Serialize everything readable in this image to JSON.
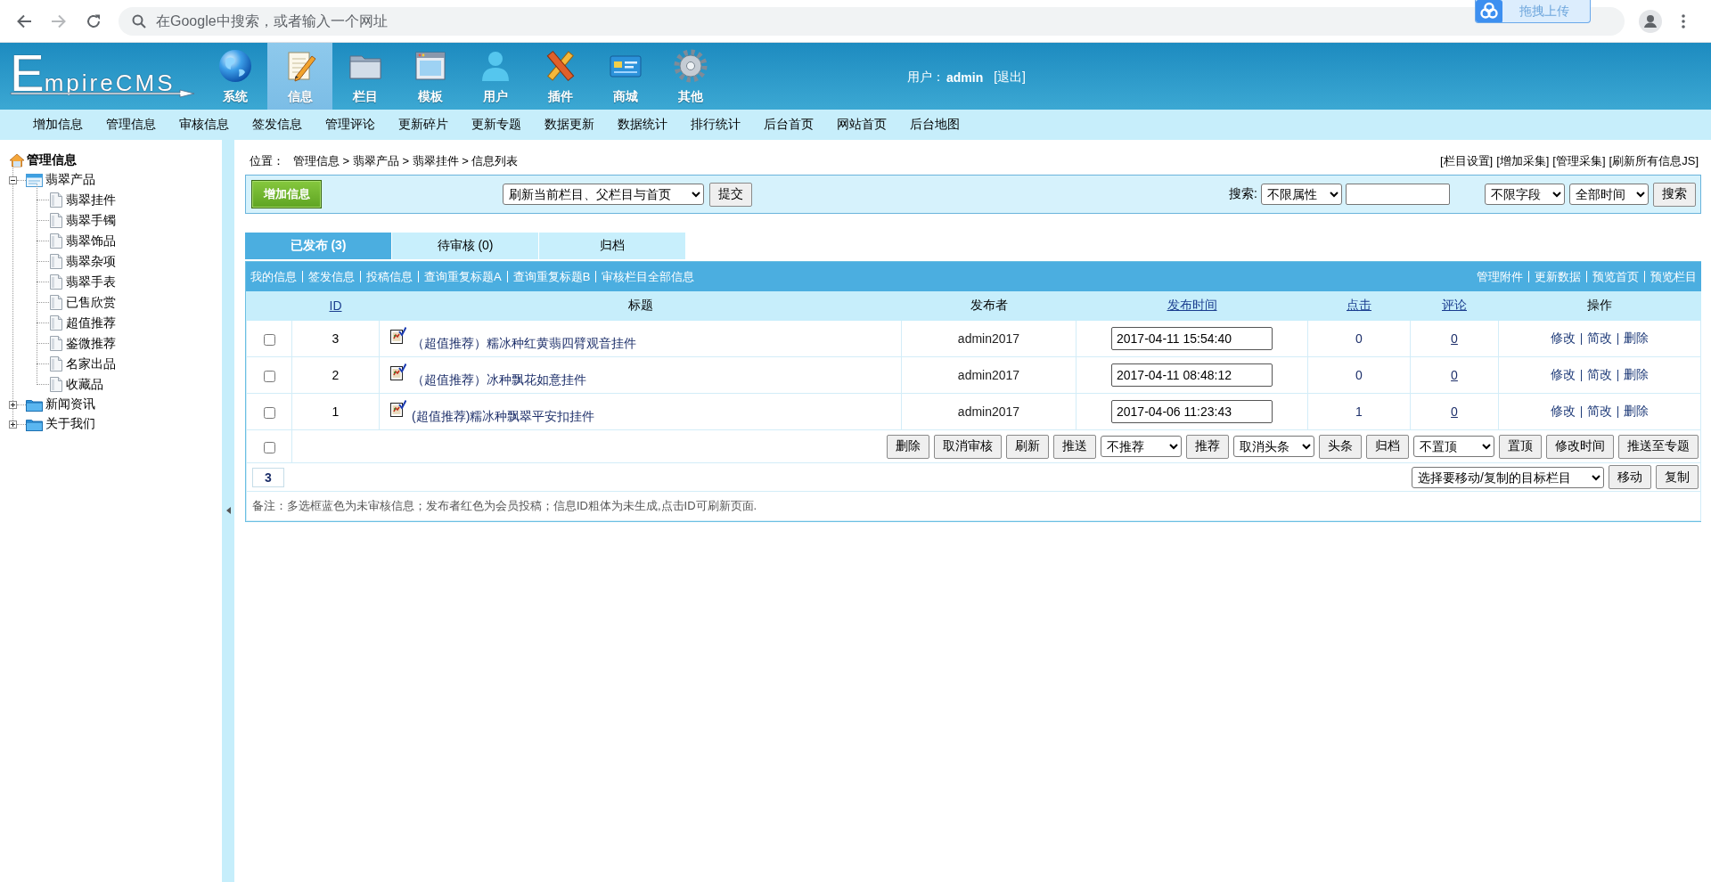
{
  "browser": {
    "address_placeholder": "在Google中搜索，或者输入一个网址",
    "extension_label": "拖拽上传"
  },
  "header": {
    "logo": "EmpireCMS",
    "nav": [
      {
        "label": "系统",
        "selected": false
      },
      {
        "label": "信息",
        "selected": true
      },
      {
        "label": "栏目",
        "selected": false
      },
      {
        "label": "模板",
        "selected": false
      },
      {
        "label": "用户",
        "selected": false
      },
      {
        "label": "插件",
        "selected": false
      },
      {
        "label": "商城",
        "selected": false
      },
      {
        "label": "其他",
        "selected": false
      }
    ],
    "user_label": "用户：",
    "user_name": "admin",
    "logout": "[退出]"
  },
  "submenu": [
    "增加信息",
    "管理信息",
    "审核信息",
    "签发信息",
    "管理评论",
    "更新碎片",
    "更新专题",
    "数据更新",
    "数据统计",
    "排行统计",
    "后台首页",
    "网站首页",
    "后台地图"
  ],
  "sidebar": {
    "title": "管理信息",
    "tree": [
      {
        "label": "翡翠产品",
        "expanded": true,
        "children": [
          {
            "label": "翡翠挂件"
          },
          {
            "label": "翡翠手镯"
          },
          {
            "label": "翡翠饰品"
          },
          {
            "label": "翡翠杂项"
          },
          {
            "label": "翡翠手表"
          },
          {
            "label": "已售欣赏"
          },
          {
            "label": "超值推荐"
          },
          {
            "label": "鉴微推荐"
          },
          {
            "label": "名家出品"
          },
          {
            "label": "收藏品"
          }
        ]
      },
      {
        "label": "新闻资讯",
        "expanded": false
      },
      {
        "label": "关于我们",
        "expanded": false
      }
    ]
  },
  "breadcrumb": {
    "label": "位置：",
    "path": "管理信息 > 翡翠产品 > 翡翠挂件 > 信息列表"
  },
  "top_links": [
    "[栏目设置]",
    "[增加采集]",
    "[管理采集]",
    "[刷新所有信息JS]"
  ],
  "toolbar": {
    "add_button": "增加信息",
    "refresh_select": "刷新当前栏目、父栏目与首页",
    "submit": "提交",
    "search_label": "搜索:",
    "attribute_select": "不限属性",
    "field_select": "不限字段",
    "time_select": "全部时间",
    "search_button": "搜索"
  },
  "tabs": [
    {
      "label": "已发布 (3)",
      "selected": true
    },
    {
      "label": "待审核 (0)",
      "selected": false
    },
    {
      "label": "归档",
      "selected": false
    }
  ],
  "table": {
    "links_left": [
      "我的信息",
      "签发信息",
      "投稿信息",
      "查询重复标题A",
      "查询重复标题B",
      "审核栏目全部信息"
    ],
    "links_right": [
      "管理附件",
      "更新数据",
      "预览首页",
      "预览栏目"
    ],
    "columns": [
      {
        "label": "ID",
        "link": true
      },
      {
        "label": "标题",
        "link": false
      },
      {
        "label": "发布者",
        "link": false
      },
      {
        "label": "发布时间",
        "link": true
      },
      {
        "label": "点击",
        "link": true
      },
      {
        "label": "评论",
        "link": true
      },
      {
        "label": "操作",
        "link": false
      }
    ],
    "rows": [
      {
        "checked": false,
        "id": "3",
        "title": "（超值推荐）糯冰种红黄翡四臂观音挂件",
        "author": "admin2017",
        "time": "2017-04-11 15:54:40",
        "clicks": "0",
        "comments": "0",
        "actions": [
          "修改",
          "简改",
          "删除"
        ]
      },
      {
        "checked": false,
        "id": "2",
        "title": "（超值推荐）冰种飘花如意挂件",
        "author": "admin2017",
        "time": "2017-04-11 08:48:12",
        "clicks": "0",
        "comments": "0",
        "actions": [
          "修改",
          "简改",
          "删除"
        ]
      },
      {
        "checked": false,
        "id": "1",
        "title": "(超值推荐)糯冰种飘翠平安扣挂件",
        "author": "admin2017",
        "time": "2017-04-06 11:23:43",
        "clicks": "1",
        "comments": "0",
        "actions": [
          "修改",
          "简改",
          "删除"
        ]
      }
    ],
    "select_all": {
      "checked": false
    },
    "bulk_actions": [
      {
        "kind": "button",
        "label": "删除"
      },
      {
        "kind": "button",
        "label": "取消审核"
      },
      {
        "kind": "button",
        "label": "刷新"
      },
      {
        "kind": "button",
        "label": "推送"
      },
      {
        "kind": "select",
        "label": "不推荐"
      },
      {
        "kind": "button",
        "label": "推荐"
      },
      {
        "kind": "select",
        "label": "取消头条"
      },
      {
        "kind": "button",
        "label": "头条"
      },
      {
        "kind": "button",
        "label": "归档"
      },
      {
        "kind": "select",
        "label": "不置顶"
      },
      {
        "kind": "button",
        "label": "置顶"
      },
      {
        "kind": "button",
        "label": "修改时间"
      },
      {
        "kind": "button",
        "label": "推送至专题"
      }
    ],
    "page": "3",
    "target_select": "选择要移动/复制的目标栏目",
    "move": "移动",
    "copy": "复制",
    "note": "备注：多选框蓝色为未审核信息；发布者红色为会员投稿；信息ID粗体为未生成,点击ID可刷新页面."
  }
}
